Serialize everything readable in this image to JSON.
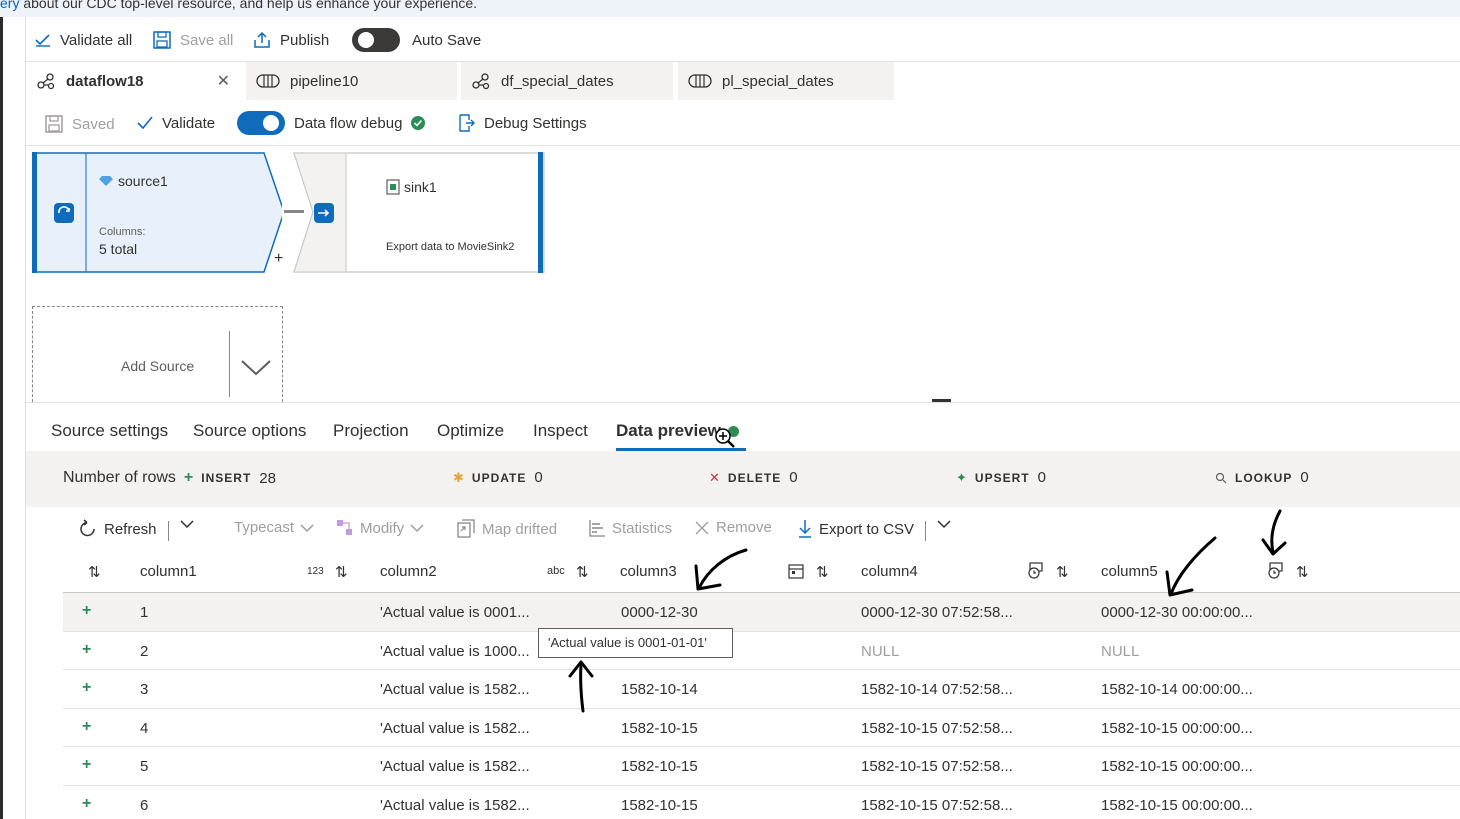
{
  "banner": {
    "link_text": "ery",
    "text": " about our CDC top-level resource, and help us enhance your experience."
  },
  "toolbar": {
    "validate_all": "Validate all",
    "save_all": "Save all",
    "publish": "Publish",
    "auto_save": "Auto Save"
  },
  "tabs": [
    {
      "label": "dataflow18",
      "icon": "dataflow-icon"
    },
    {
      "label": "pipeline10",
      "icon": "pipeline-icon"
    },
    {
      "label": "df_special_dates",
      "icon": "dataflow-icon"
    },
    {
      "label": "pl_special_dates",
      "icon": "pipeline-icon"
    }
  ],
  "subbar": {
    "saved": "Saved",
    "validate": "Validate",
    "data_flow_debug": "Data flow debug",
    "debug_settings": "Debug Settings"
  },
  "canvas": {
    "source": {
      "name": "source1",
      "columns_label": "Columns:",
      "columns_value": "5 total"
    },
    "sink": {
      "name": "sink1",
      "description": "Export data to MovieSink2"
    },
    "add_source": "Add Source"
  },
  "panel_tabs": [
    "Source settings",
    "Source options",
    "Projection",
    "Optimize",
    "Inspect",
    "Data preview"
  ],
  "stats": {
    "rows_label": "Number of rows",
    "insert_label": "INSERT",
    "insert_value": "28",
    "update_label": "UPDATE",
    "update_value": "0",
    "delete_label": "DELETE",
    "delete_value": "0",
    "upsert_label": "UPSERT",
    "upsert_value": "0",
    "lookup_label": "LOOKUP",
    "lookup_value": "0"
  },
  "preview_toolbar": {
    "refresh": "Refresh",
    "typecast": "Typecast",
    "modify": "Modify",
    "map_drifted": "Map drifted",
    "statistics": "Statistics",
    "remove": "Remove",
    "export_csv": "Export to CSV"
  },
  "grid": {
    "columns": [
      {
        "name": "column1",
        "type_badge": "123"
      },
      {
        "name": "column2",
        "type_badge": "abc"
      },
      {
        "name": "column3",
        "type_badge": "calendar-icon"
      },
      {
        "name": "column4",
        "type_badge": "datetime-icon"
      },
      {
        "name": "column5",
        "type_badge": "datetime-icon"
      }
    ],
    "rows": [
      [
        "1",
        "'Actual value is 0001...",
        "0000-12-30",
        "0000-12-30 07:52:58...",
        "0000-12-30 00:00:00..."
      ],
      [
        "2",
        "'Actual value is 1000...",
        "",
        "NULL",
        "NULL"
      ],
      [
        "3",
        "'Actual value is 1582...",
        "1582-10-14",
        "1582-10-14 07:52:58...",
        "1582-10-14 00:00:00..."
      ],
      [
        "4",
        "'Actual value is 1582...",
        "1582-10-15",
        "1582-10-15 07:52:58...",
        "1582-10-15 00:00:00..."
      ],
      [
        "5",
        "'Actual value is 1582...",
        "1582-10-15",
        "1582-10-15 07:52:58...",
        "1582-10-15 00:00:00..."
      ],
      [
        "6",
        "'Actual value is 1582...",
        "1582-10-15",
        "1582-10-15 07:52:58...",
        "1582-10-15 00:00:00..."
      ]
    ]
  },
  "tooltip": "'Actual value is 0001-01-01'",
  "colors": {
    "accent": "#0f6cbd",
    "success": "#2e8b57",
    "delete": "#d13438",
    "update": "#e8a33d"
  }
}
